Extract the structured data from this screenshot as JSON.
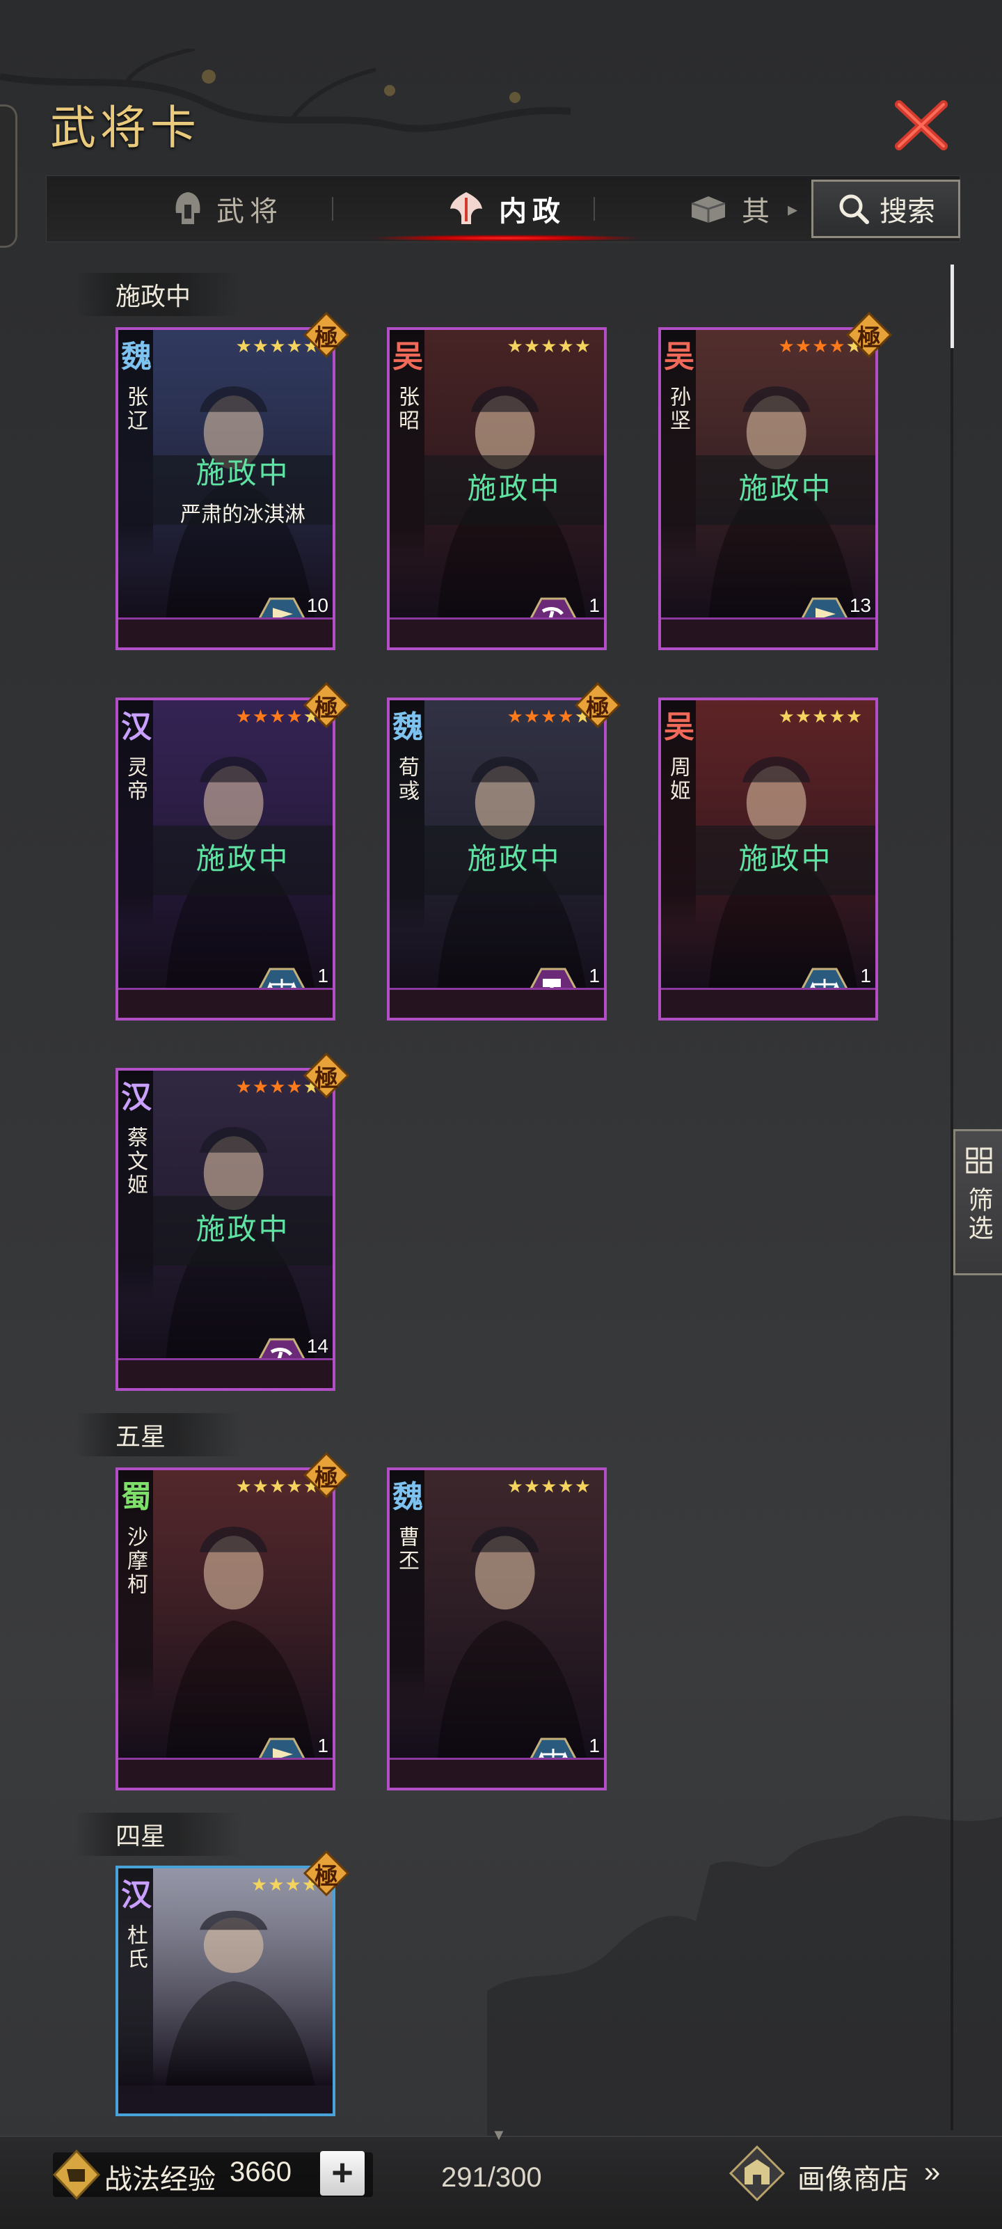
{
  "header": {
    "title": "武将卡",
    "close_icon": "close-x-icon"
  },
  "tabs": [
    {
      "label": "武将",
      "icon": "helmet-icon",
      "active": false
    },
    {
      "label": "内政",
      "icon": "politics-icon",
      "active": true
    },
    {
      "label": "其",
      "icon": "chest-icon",
      "active": false
    }
  ],
  "search": {
    "label": "搜索",
    "icon": "search-icon"
  },
  "filter": {
    "label": "筛选",
    "icon": "grid-icon"
  },
  "sections": [
    {
      "label": "施政中"
    },
    {
      "label": "五星"
    },
    {
      "label": "四星"
    }
  ],
  "overlay_text": "施政中",
  "ji_badge": "極",
  "cards": [
    {
      "faction": "魏",
      "faction_color": "#7ec3f0",
      "name": "张辽",
      "stars": 5,
      "star_color": "#f4d35e",
      "ji": true,
      "status": "施政中",
      "sub": "严肃的冰淇淋",
      "skill": "flag-icon",
      "skill_count": "10",
      "bg": "#3a4a7a"
    },
    {
      "faction": "吴",
      "faction_color": "#f06a5a",
      "name": "张昭",
      "stars": 5,
      "star_color": "#f4d35e",
      "ji": false,
      "status": "施政中",
      "sub": "",
      "skill": "pick-icon",
      "skill_count": "1",
      "bg": "#5a2a26"
    },
    {
      "faction": "吴",
      "faction_color": "#f06a5a",
      "name": "孙坚",
      "stars": 5,
      "star_color": "#ff7a1a",
      "ji": true,
      "status": "施政中",
      "sub": "",
      "skill": "flag-icon",
      "skill_count": "13",
      "bg": "#6a3a32"
    },
    {
      "faction": "汉",
      "faction_color": "#c9a0ff",
      "name": "灵帝",
      "stars": 5,
      "star_color": "#ff7a1a",
      "ji": true,
      "status": "施政中",
      "sub": "",
      "skill": "scale-icon",
      "skill_count": "1",
      "bg": "#3f2a6a"
    },
    {
      "faction": "魏",
      "faction_color": "#7ec3f0",
      "name": "荀彧",
      "stars": 5,
      "star_color": "#ff7a1a",
      "ji": true,
      "status": "施政中",
      "sub": "",
      "skill": "hammer-icon",
      "skill_count": "1",
      "bg": "#3a3e52"
    },
    {
      "faction": "吴",
      "faction_color": "#f06a5a",
      "name": "周姬",
      "stars": 5,
      "star_color": "#f4d35e",
      "ji": false,
      "status": "施政中",
      "sub": "",
      "skill": "scale-icon",
      "skill_count": "1",
      "bg": "#7a2a28"
    },
    {
      "faction": "汉",
      "faction_color": "#c9a0ff",
      "name": "蔡文姬",
      "stars": 5,
      "star_color": "#ff7a1a",
      "ji": true,
      "status": "施政中",
      "sub": "",
      "skill": "pick-icon",
      "skill_count": "14",
      "bg": "#3a3050"
    },
    {
      "faction": "蜀",
      "faction_color": "#7ee06a",
      "name": "沙摩柯",
      "stars": 5,
      "star_color": "#f4d35e",
      "ji": true,
      "status": "",
      "sub": "",
      "skill": "flag-icon",
      "skill_count": "1",
      "bg": "#6a3030"
    },
    {
      "faction": "魏",
      "faction_color": "#7ec3f0",
      "name": "曹丕",
      "stars": 5,
      "star_color": "#f4d35e",
      "ji": false,
      "status": "",
      "sub": "",
      "skill": "scale-icon",
      "skill_count": "1",
      "bg": "#4a2e30"
    },
    {
      "faction": "汉",
      "faction_color": "#c9a0ff",
      "name": "杜氏",
      "stars": 4,
      "star_color": "#f4d35e",
      "ji": true,
      "status": "",
      "sub": "",
      "skill": "",
      "skill_count": "",
      "bg": "#c8cde0"
    }
  ],
  "footer": {
    "exp_label": "战法经验",
    "exp_value": "3660",
    "plus": "+",
    "count": "291/300",
    "shop_label": "画像商店",
    "shop_arrow": "»"
  }
}
